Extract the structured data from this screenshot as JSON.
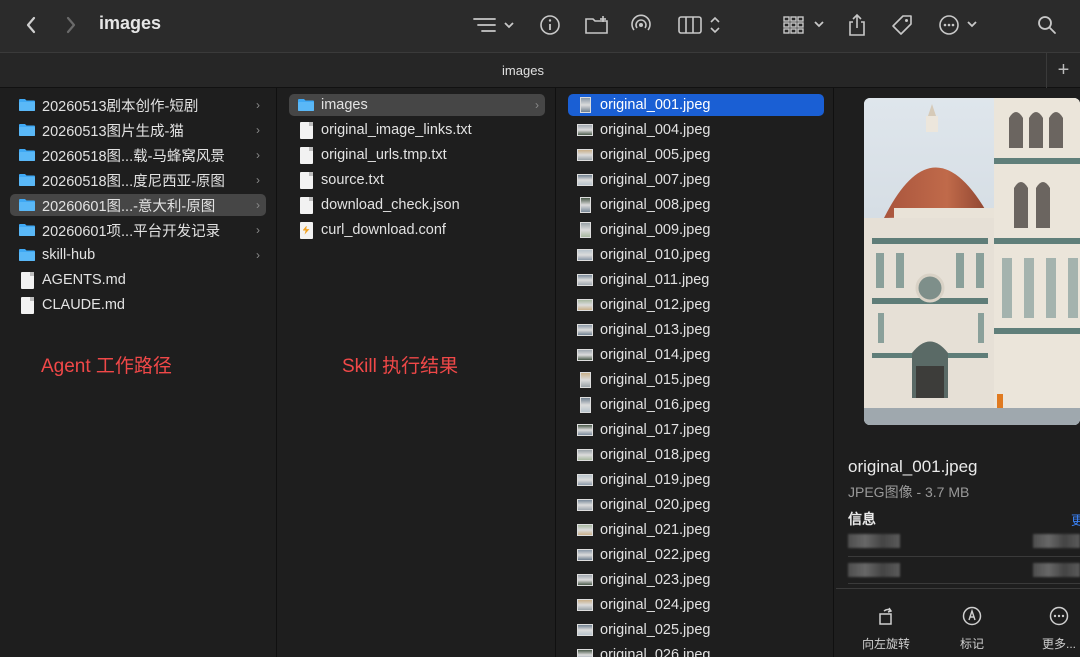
{
  "window": {
    "title": "images"
  },
  "tab": {
    "title": "images",
    "add_label": "+"
  },
  "column1": {
    "items": [
      {
        "label": "20260513剧本创作-短剧",
        "type": "folder",
        "chevron": true
      },
      {
        "label": "20260513图片生成-猫",
        "type": "folder",
        "chevron": true
      },
      {
        "label": "20260518图...载-马蜂窝风景",
        "type": "folder",
        "chevron": true
      },
      {
        "label": "20260518图...度尼西亚-原图",
        "type": "folder",
        "chevron": true
      },
      {
        "label": "20260601图...-意大利-原图",
        "type": "folder",
        "chevron": true,
        "selected": true
      },
      {
        "label": "20260601项...平台开发记录",
        "type": "folder",
        "chevron": true
      },
      {
        "label": "skill-hub",
        "type": "folder",
        "chevron": true
      },
      {
        "label": "AGENTS.md",
        "type": "doc"
      },
      {
        "label": "CLAUDE.md",
        "type": "doc"
      }
    ],
    "annotation": "Agent 工作路径"
  },
  "column2": {
    "items": [
      {
        "label": "images",
        "type": "folder",
        "chevron": true,
        "selected": true
      },
      {
        "label": "original_image_links.txt",
        "type": "doc"
      },
      {
        "label": "original_urls.tmp.txt",
        "type": "doc"
      },
      {
        "label": "source.txt",
        "type": "doc"
      },
      {
        "label": "download_check.json",
        "type": "doc"
      },
      {
        "label": "curl_download.conf",
        "type": "conf"
      }
    ],
    "annotation": "Skill 执行结果"
  },
  "column3": {
    "items": [
      "original_001.jpeg",
      "original_004.jpeg",
      "original_005.jpeg",
      "original_007.jpeg",
      "original_008.jpeg",
      "original_009.jpeg",
      "original_010.jpeg",
      "original_011.jpeg",
      "original_012.jpeg",
      "original_013.jpeg",
      "original_014.jpeg",
      "original_015.jpeg",
      "original_016.jpeg",
      "original_017.jpeg",
      "original_018.jpeg",
      "original_019.jpeg",
      "original_020.jpeg",
      "original_021.jpeg",
      "original_022.jpeg",
      "original_023.jpeg",
      "original_024.jpeg",
      "original_025.jpeg",
      "original_026.jpeg"
    ],
    "selected_index": 0
  },
  "preview": {
    "file_name": "original_001.jpeg",
    "kind": "JPEG图像 - 3.7 MB",
    "info_heading": "信息",
    "more_link": "更",
    "actions": [
      {
        "label": "向左旋转",
        "icon": "rotate-left-icon"
      },
      {
        "label": "标记",
        "icon": "markup-icon"
      },
      {
        "label": "更多...",
        "icon": "more-icon"
      }
    ]
  },
  "colors": {
    "selection_blue": "#1a5fd4",
    "folder_blue": "#3fa9f5",
    "annotation_red": "#f04848"
  }
}
